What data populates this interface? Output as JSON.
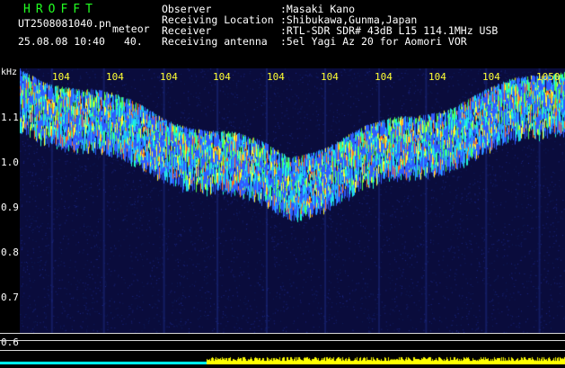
{
  "header": {
    "brand": "HROFFT",
    "filename": "UT2508081040.pn",
    "mode": "meteor",
    "datetime": "25.08.08 10:40",
    "count": "40.",
    "info_labels": [
      "Observer",
      "Receiving Location",
      "Receiver",
      "Receiving antenna"
    ],
    "info_values": [
      ":Masaki Kano",
      ":Shibukawa,Gunma,Japan",
      ":RTL-SDR SDR# 43dB L15 114.1MHz USB",
      ":5el Yagi Az 20 for Aomori VOR"
    ]
  },
  "y_axis": {
    "unit": "kHz",
    "ticks": [
      "1.1",
      "1.0",
      "0.9",
      "0.8",
      "0.7",
      "0.6"
    ]
  },
  "x_axis": {
    "ticks": [
      "104",
      "104",
      "104",
      "104",
      "104",
      "104",
      "104",
      "104",
      "104",
      "1050"
    ]
  },
  "colors": {
    "background": "#000000",
    "plot_bg": "#0a0c3c",
    "brand": "#22ff22",
    "text": "#ffffff",
    "tick": "#ffff33",
    "noise_bar": "#ffff00",
    "baseline": "#00ffff"
  }
}
